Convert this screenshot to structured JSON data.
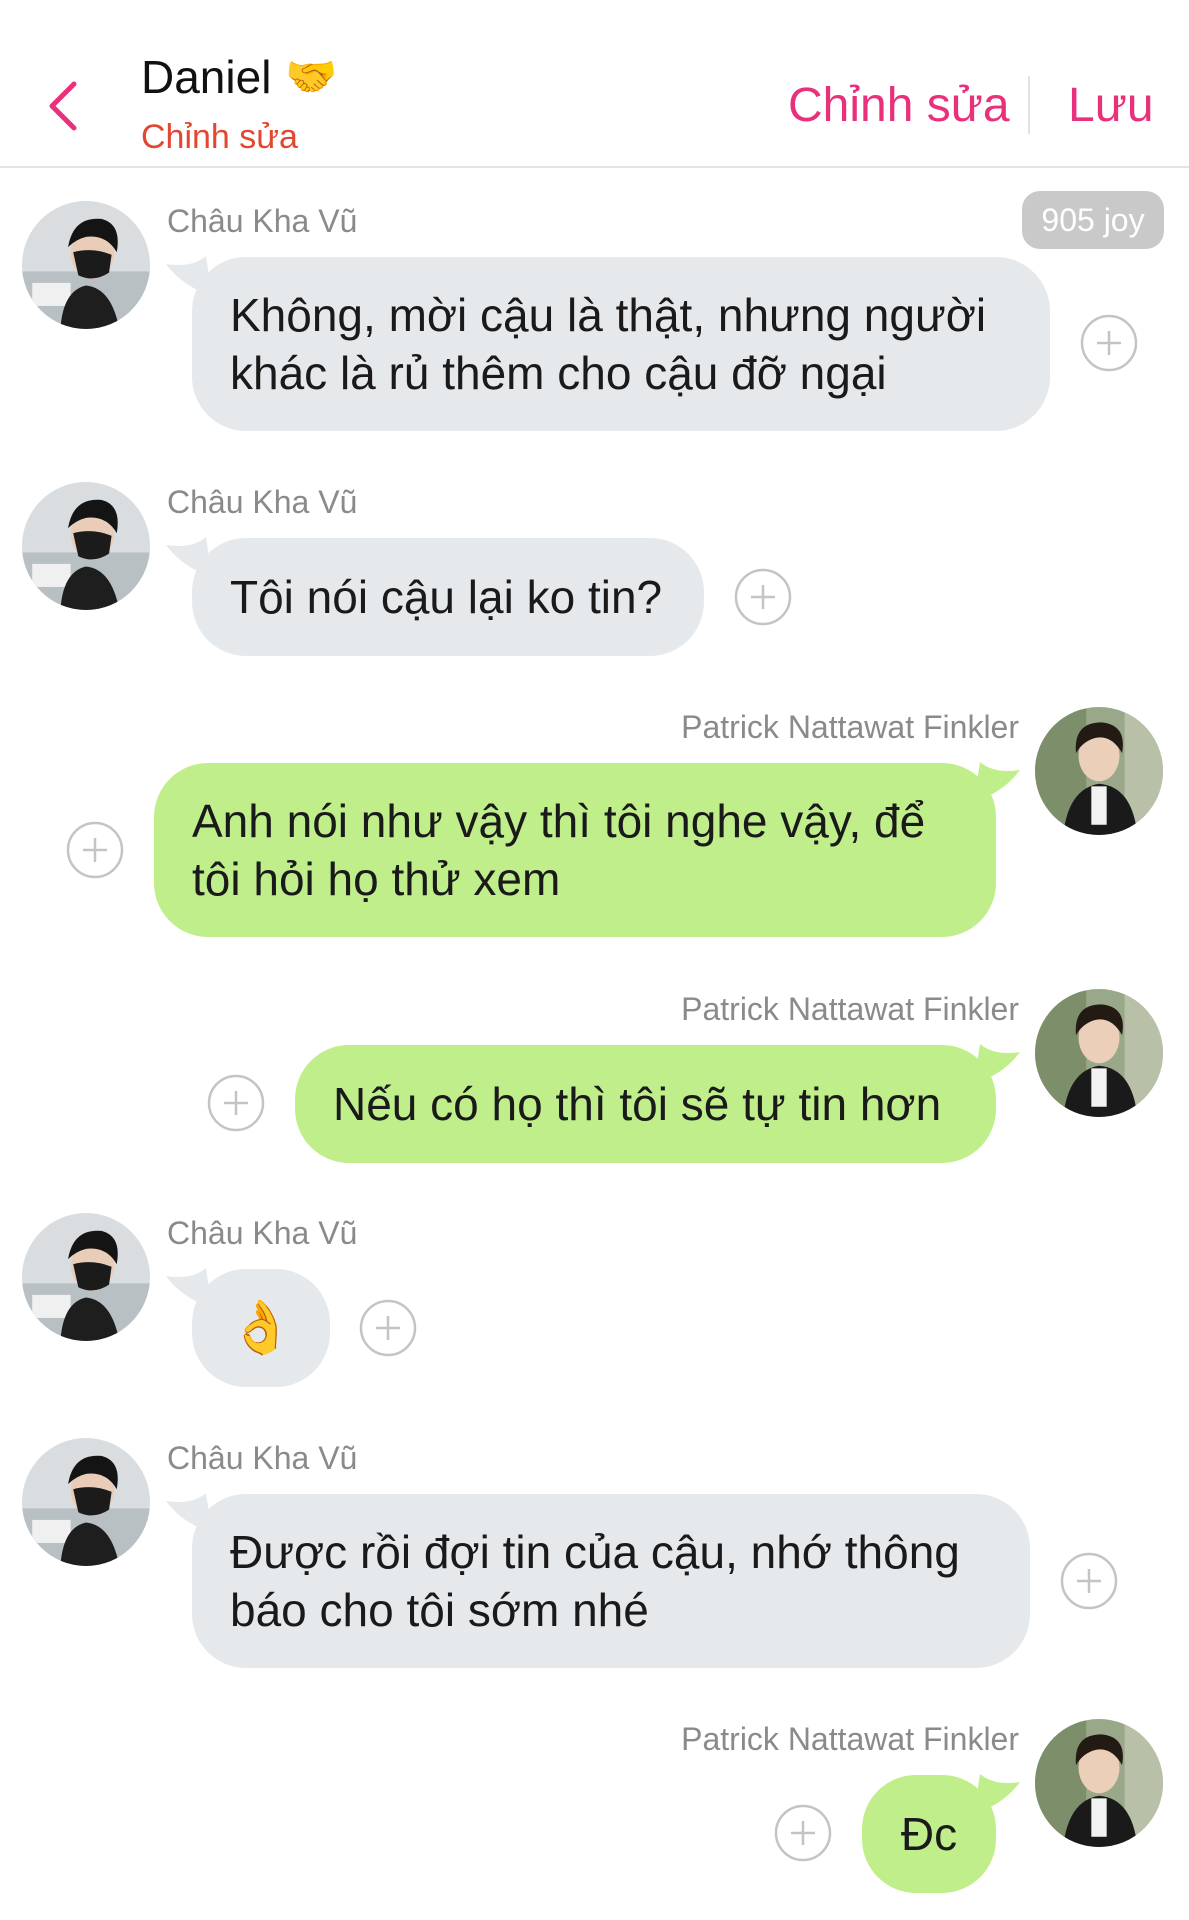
{
  "header": {
    "back_label": "back",
    "title": "Daniel",
    "title_emoji": "🤝",
    "subtitle": "Chỉnh sửa",
    "edit_label": "Chỉnh sửa",
    "save_label": "Lưu"
  },
  "joy_badge": "905 joy",
  "colors": {
    "accent": "#e8317a",
    "subtitle": "#e4462f",
    "incoming_bubble": "#e6e9ec",
    "outgoing_bubble": "#c0ee8b"
  },
  "messages": [
    {
      "sender": "Châu Kha Vũ",
      "direction": "incoming",
      "text": "Không, mời cậu là thật, nhưng người khác là rủ thêm cho cậu đỡ ngại"
    },
    {
      "sender": "Châu Kha Vũ",
      "direction": "incoming",
      "text": "Tôi nói cậu lại ko tin?"
    },
    {
      "sender": "Patrick Nattawat Finkler",
      "direction": "outgoing",
      "text": "Anh nói như vậy thì tôi nghe vậy, để tôi hỏi họ thử xem"
    },
    {
      "sender": "Patrick Nattawat Finkler",
      "direction": "outgoing",
      "text": "Nếu có họ thì tôi sẽ tự tin hơn"
    },
    {
      "sender": "Châu Kha Vũ",
      "direction": "incoming",
      "text": "👌"
    },
    {
      "sender": "Châu Kha Vũ",
      "direction": "incoming",
      "text": "Được rồi đợi tin của cậu, nhớ thông báo cho tôi sớm nhé"
    },
    {
      "sender": "Patrick Nattawat Finkler",
      "direction": "outgoing",
      "text": "Đc"
    }
  ]
}
